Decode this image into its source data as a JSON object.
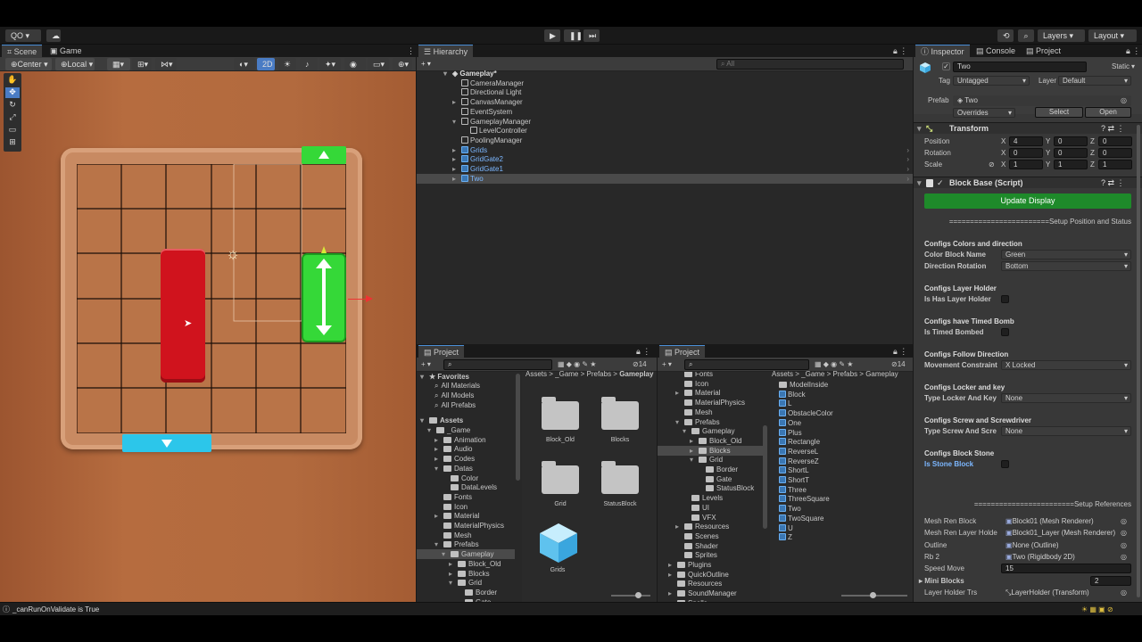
{
  "topbar": {
    "account": "QO",
    "layers": "Layers",
    "layout": "Layout"
  },
  "scene": {
    "tabs": [
      "Scene",
      "Game"
    ],
    "pivot": "Center",
    "space": "Local",
    "mode_2d": "2D"
  },
  "hierarchy": {
    "tab": "Hierarchy",
    "search_placeholder": "All",
    "scene_name": "Gameplay*",
    "items": [
      {
        "label": "CameraManager",
        "indent": 1,
        "blue": false,
        "fold": ""
      },
      {
        "label": "Directional Light",
        "indent": 1,
        "blue": false,
        "fold": ""
      },
      {
        "label": "CanvasManager",
        "indent": 1,
        "blue": false,
        "fold": "▸"
      },
      {
        "label": "EventSystem",
        "indent": 1,
        "blue": false,
        "fold": ""
      },
      {
        "label": "GameplayManager",
        "indent": 1,
        "blue": false,
        "fold": "▾"
      },
      {
        "label": "LevelController",
        "indent": 2,
        "blue": false,
        "fold": ""
      },
      {
        "label": "PoolingManager",
        "indent": 1,
        "blue": false,
        "fold": ""
      },
      {
        "label": "Grids",
        "indent": 1,
        "blue": true,
        "fold": "▸"
      },
      {
        "label": "GridGate2",
        "indent": 1,
        "blue": true,
        "fold": "▸"
      },
      {
        "label": "GridGate1",
        "indent": 1,
        "blue": true,
        "fold": "▸"
      },
      {
        "label": "Two",
        "indent": 1,
        "blue": true,
        "fold": "▸"
      }
    ]
  },
  "project1": {
    "tab": "Project",
    "count": "14",
    "favorites_label": "Favorites",
    "favorites": [
      "All Materials",
      "All Models",
      "All Prefabs"
    ],
    "assets_label": "Assets",
    "tree": [
      {
        "label": "_Game",
        "indent": 1,
        "fold": "▾"
      },
      {
        "label": "Animation",
        "indent": 2,
        "fold": "▸"
      },
      {
        "label": "Audio",
        "indent": 2,
        "fold": "▸"
      },
      {
        "label": "Codes",
        "indent": 2,
        "fold": "▸"
      },
      {
        "label": "Datas",
        "indent": 2,
        "fold": "▾"
      },
      {
        "label": "Color",
        "indent": 3,
        "fold": ""
      },
      {
        "label": "DataLevels",
        "indent": 3,
        "fold": ""
      },
      {
        "label": "Fonts",
        "indent": 2,
        "fold": ""
      },
      {
        "label": "Icon",
        "indent": 2,
        "fold": ""
      },
      {
        "label": "Material",
        "indent": 2,
        "fold": "▸"
      },
      {
        "label": "MaterialPhysics",
        "indent": 2,
        "fold": ""
      },
      {
        "label": "Mesh",
        "indent": 2,
        "fold": ""
      },
      {
        "label": "Prefabs",
        "indent": 2,
        "fold": "▾"
      },
      {
        "label": "Gameplay",
        "indent": 3,
        "fold": "▾"
      },
      {
        "label": "Block_Old",
        "indent": 4,
        "fold": "▸"
      },
      {
        "label": "Blocks",
        "indent": 4,
        "fold": "▸"
      },
      {
        "label": "Grid",
        "indent": 4,
        "fold": "▾"
      },
      {
        "label": "Border",
        "indent": 5,
        "fold": ""
      },
      {
        "label": "Gate",
        "indent": 5,
        "fold": ""
      }
    ],
    "breadcrumb": [
      "Assets",
      "_Game",
      "Prefabs",
      "Gameplay"
    ],
    "grid_items": [
      "Block_Old",
      "Blocks",
      "Grid",
      "StatusBlock",
      "Grids"
    ]
  },
  "project2": {
    "tab": "Project",
    "count": "14",
    "tree": [
      {
        "label": "Fonts",
        "indent": 2,
        "fold": ""
      },
      {
        "label": "Icon",
        "indent": 2,
        "fold": ""
      },
      {
        "label": "Material",
        "indent": 2,
        "fold": "▸"
      },
      {
        "label": "MaterialPhysics",
        "indent": 2,
        "fold": ""
      },
      {
        "label": "Mesh",
        "indent": 2,
        "fold": ""
      },
      {
        "label": "Prefabs",
        "indent": 2,
        "fold": "▾"
      },
      {
        "label": "Gameplay",
        "indent": 3,
        "fold": "▾"
      },
      {
        "label": "Block_Old",
        "indent": 4,
        "fold": "▸"
      },
      {
        "label": "Blocks",
        "indent": 4,
        "fold": "▸"
      },
      {
        "label": "Grid",
        "indent": 4,
        "fold": "▾"
      },
      {
        "label": "Border",
        "indent": 5,
        "fold": ""
      },
      {
        "label": "Gate",
        "indent": 5,
        "fold": ""
      },
      {
        "label": "StatusBlock",
        "indent": 5,
        "fold": ""
      },
      {
        "label": "Levels",
        "indent": 3,
        "fold": ""
      },
      {
        "label": "UI",
        "indent": 3,
        "fold": ""
      },
      {
        "label": "VFX",
        "indent": 3,
        "fold": ""
      },
      {
        "label": "Resources",
        "indent": 2,
        "fold": "▸"
      },
      {
        "label": "Scenes",
        "indent": 2,
        "fold": ""
      },
      {
        "label": "Shader",
        "indent": 2,
        "fold": ""
      },
      {
        "label": "Sprites",
        "indent": 2,
        "fold": ""
      },
      {
        "label": "Plugins",
        "indent": 1,
        "fold": "▸"
      },
      {
        "label": "QuickOutline",
        "indent": 1,
        "fold": "▸"
      },
      {
        "label": "Resources",
        "indent": 1,
        "fold": ""
      },
      {
        "label": "SoundManager",
        "indent": 1,
        "fold": "▸"
      },
      {
        "label": "Spells",
        "indent": 1,
        "fold": ""
      }
    ],
    "breadcrumb": [
      "Assets",
      "_Game",
      "Prefabs",
      "Gameplay"
    ],
    "list": [
      "ModelInside",
      "Block",
      "L",
      "ObstacleColor",
      "One",
      "Plus",
      "Rectangle",
      "ReverseL",
      "ReverseZ",
      "ShortL",
      "ShortT",
      "Three",
      "ThreeSquare",
      "Two",
      "TwoSquare",
      "U",
      "Z"
    ]
  },
  "inspector": {
    "tabs": [
      "Inspector",
      "Console",
      "Project"
    ],
    "object_name": "Two",
    "static_label": "Static",
    "tag_label": "Tag",
    "tag_value": "Untagged",
    "layer_label": "Layer",
    "layer_value": "Default",
    "prefab_label": "Prefab",
    "prefab_value": "Two",
    "overrides": "Overrides",
    "select": "Select",
    "open": "Open",
    "transform": {
      "title": "Transform",
      "rows": [
        {
          "label": "Position",
          "x": "4",
          "y": "0",
          "z": "0"
        },
        {
          "label": "Rotation",
          "x": "0",
          "y": "0",
          "z": "0"
        },
        {
          "label": "Scale",
          "x": "1",
          "y": "1",
          "z": "1"
        }
      ],
      "axis": [
        "X",
        "Y",
        "Z"
      ]
    },
    "script": {
      "title": "Block Base (Script)",
      "update_button": "Update Display",
      "sep1": "========================Setup Position and Status",
      "sections": [
        {
          "header": "Configs Colors and direction",
          "rows": [
            {
              "label": "Color Block Name",
              "value": "Green",
              "kind": "dropdown"
            },
            {
              "label": "Direction Rotation",
              "value": "Bottom",
              "kind": "dropdown"
            }
          ]
        },
        {
          "header": "Configs Layer Holder",
          "rows": [
            {
              "label": "Is Has Layer Holder",
              "value": "",
              "kind": "check"
            }
          ]
        },
        {
          "header": "Configs have Timed Bomb",
          "rows": [
            {
              "label": "Is Timed Bombed",
              "value": "",
              "kind": "check"
            }
          ]
        },
        {
          "header": "Configs Follow Direction",
          "rows": [
            {
              "label": "Movement Constraint",
              "value": "X Locked",
              "kind": "dropdown"
            }
          ]
        },
        {
          "header": "Configs Locker and key",
          "rows": [
            {
              "label": "Type Locker And Key",
              "value": "None",
              "kind": "dropdown"
            }
          ]
        },
        {
          "header": "Configs Screw and Screwdriver",
          "rows": [
            {
              "label": "Type Screw And Scre",
              "value": "None",
              "kind": "dropdown"
            }
          ]
        },
        {
          "header": "Configs Block Stone",
          "rows": [
            {
              "label": "Is Stone Block",
              "value": "",
              "kind": "check"
            }
          ]
        }
      ],
      "sep2": "========================Setup References",
      "refs": [
        {
          "label": "Mesh Ren Block",
          "value": "Block01 (Mesh Renderer)"
        },
        {
          "label": "Mesh Ren Layer Holde",
          "value": "Block01_Layer (Mesh Renderer)"
        },
        {
          "label": "Outline",
          "value": "None (Outline)"
        },
        {
          "label": "Rb 2",
          "value": "Two (Rigidbody 2D)"
        },
        {
          "label": "Speed Move",
          "value": "15"
        }
      ],
      "mini_blocks_label": "Mini Blocks",
      "mini_blocks_count": "2",
      "layer_holder_label": "Layer Holder Trs",
      "layer_holder_value": "LayerHolder (Transform)"
    }
  },
  "status": {
    "message": "_canRunOnValidate is True"
  },
  "colors": {
    "accent_blue": "#4a8fd8",
    "selection": "#2c5d87",
    "update_green": "#1e8a2a",
    "block_red": "#d0131d",
    "block_green": "#35d838",
    "gate_cyan": "#2cc6ea",
    "wood": "#b26a3e"
  }
}
